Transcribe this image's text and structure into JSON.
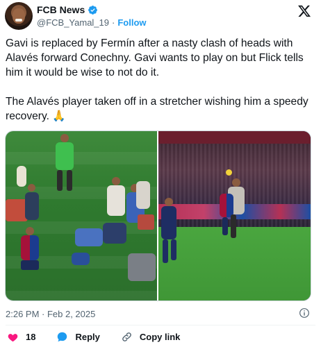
{
  "header": {
    "display_name": "FCB News",
    "handle": "@FCB_Yamal_19",
    "separator": "·",
    "follow_label": "Follow",
    "icons": {
      "verified": "verified-badge-icon",
      "platform": "x-logo-icon",
      "avatar": "avatar"
    }
  },
  "tweet": {
    "paragraphs": [
      "Gavi is replaced by Fermín after a nasty clash of heads with Alavés forward Conechny. Gavi wants to play on but Flick tells him it would be wise to not do it.",
      "The Alavés player taken off in a stretcher wishing him a speedy recovery. 🙏"
    ],
    "timestamp": "2:26 PM · Feb 2, 2025"
  },
  "media": {
    "photos": [
      "photo-injury-on-pitch",
      "photo-head-clash"
    ]
  },
  "actions": {
    "like_count": "18",
    "reply_label": "Reply",
    "copy_link_label": "Copy link"
  },
  "colors": {
    "accent": "#1d9bf0",
    "like": "#f91880",
    "secondary_text": "#536471",
    "primary_text": "#0f1419"
  }
}
